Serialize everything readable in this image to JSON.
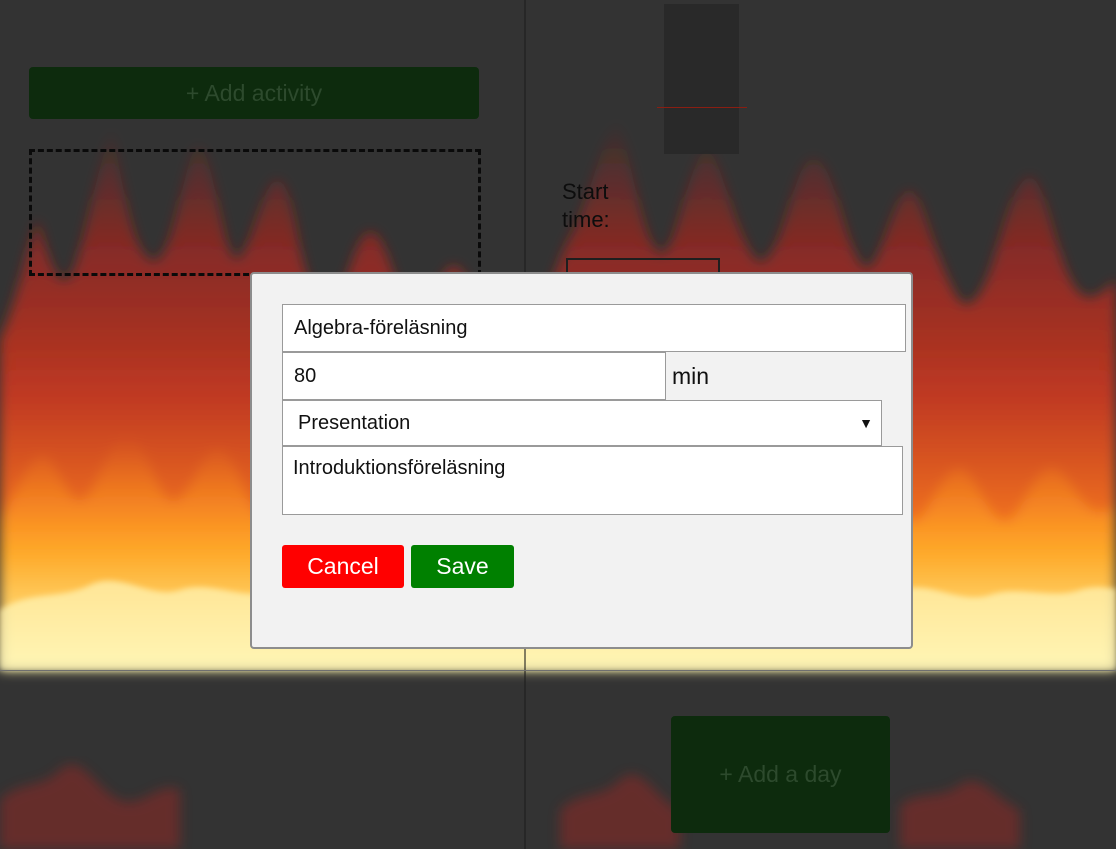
{
  "planner": {
    "add_activity_label": "+ Add activity",
    "add_day_label": "+ Add a day",
    "start_time_label": "Start time:"
  },
  "activity_form": {
    "name_value": "Algebra-föreläsning",
    "duration_value": "80",
    "duration_unit": "min",
    "type_value": "Presentation",
    "type_arrow": "▼",
    "description_value": "Introduktionsföreläsning",
    "cancel_label": "Cancel",
    "save_label": "Save"
  },
  "colors": {
    "background": "#333333",
    "modal_background": "#f2f2f2",
    "cancel_button": "#ff0000",
    "save_button": "#008000",
    "add_button": "#0d2b0d",
    "flame_hot": "#fff2a0",
    "flame_mid": "#ff7a1a",
    "flame_cool": "#c4231a"
  },
  "icons": {
    "dropdown": "triangle-down"
  }
}
